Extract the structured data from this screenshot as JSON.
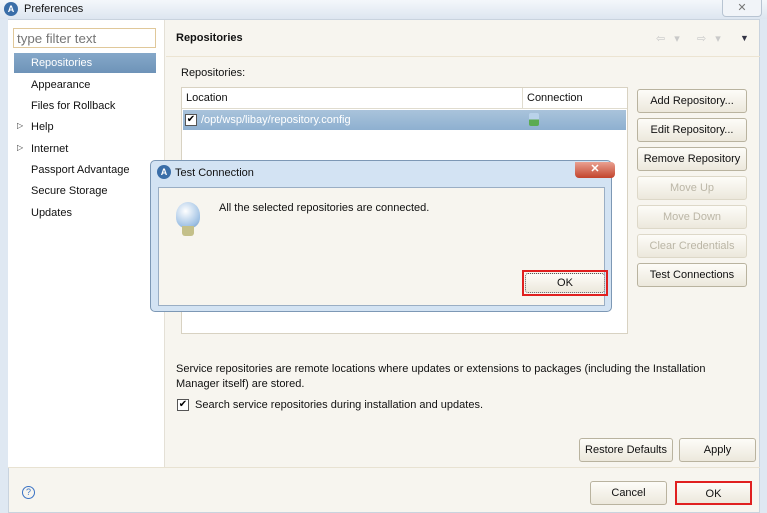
{
  "window": {
    "title": "Preferences",
    "close": "✕"
  },
  "sidebar": {
    "filter_placeholder": "type filter text",
    "items": [
      {
        "label": "Repositories",
        "selected": true
      },
      {
        "label": "Appearance"
      },
      {
        "label": "Files for Rollback"
      },
      {
        "label": "Help",
        "expandable": true
      },
      {
        "label": "Internet",
        "expandable": true
      },
      {
        "label": "Passport Advantage"
      },
      {
        "label": "Secure Storage"
      },
      {
        "label": "Updates"
      }
    ]
  },
  "page": {
    "title": "Repositories",
    "nav_back": "⇦ ▾",
    "nav_fwd": "⇨ ▾",
    "menu": "▼",
    "list_label": "Repositories:",
    "columns": [
      "Location",
      "Connection"
    ],
    "rows": [
      {
        "checked": true,
        "location": "/opt/wsp/libay/repository.config",
        "connection_icon": "connection-ok-icon"
      }
    ],
    "buttons": [
      {
        "label": "Add Repository...",
        "enabled": true
      },
      {
        "label": "Edit Repository...",
        "enabled": true
      },
      {
        "label": "Remove Repository",
        "enabled": true
      },
      {
        "label": "Move Up",
        "enabled": false
      },
      {
        "label": "Move Down",
        "enabled": false
      },
      {
        "label": "Clear Credentials",
        "enabled": false
      },
      {
        "label": "Test Connections",
        "enabled": true
      }
    ],
    "description": "Service repositories are remote locations where updates or extensions to packages (including the Installation Manager itself) are stored.",
    "search_checkbox": {
      "label": "Search service repositories during installation and updates.",
      "checked": true
    },
    "restore_defaults": "Restore Defaults",
    "apply": "Apply"
  },
  "footer": {
    "help": "?",
    "cancel": "Cancel",
    "ok": "OK"
  },
  "dialog": {
    "title": "Test Connection",
    "message": "All the selected repositories are connected.",
    "ok": "OK",
    "close": "✕"
  },
  "colors": {
    "highlight": "#e02020",
    "selection": "#7a9dc2"
  }
}
